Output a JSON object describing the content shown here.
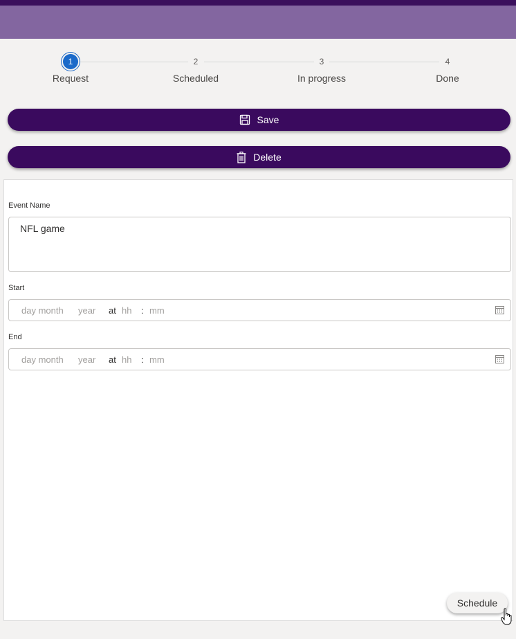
{
  "stepper": {
    "steps": [
      {
        "number": "1",
        "label": "Request",
        "state": "active"
      },
      {
        "number": "2",
        "label": "Scheduled",
        "state": "pending"
      },
      {
        "number": "3",
        "label": "In progress",
        "state": "pending"
      },
      {
        "number": "4",
        "label": "Done",
        "state": "pending"
      }
    ]
  },
  "actions": {
    "save_label": "Save",
    "save_icon": "save-icon",
    "delete_label": "Delete",
    "delete_icon": "trash-icon"
  },
  "form": {
    "event_name": {
      "label": "Event Name",
      "value": "NFL game"
    },
    "start": {
      "label": "Start",
      "day_month_placeholder": "day month",
      "year_placeholder": "year",
      "at": "at",
      "hh_placeholder": "hh",
      "sep": ":",
      "mm_placeholder": "mm",
      "icon": "calendar-icon"
    },
    "end": {
      "label": "End",
      "day_month_placeholder": "day month",
      "year_placeholder": "year",
      "at": "at",
      "hh_placeholder": "hh",
      "sep": ":",
      "mm_placeholder": "mm",
      "icon": "calendar-icon"
    }
  },
  "schedule_label": "Schedule",
  "colors": {
    "header_dark": "#3a0f5c",
    "header_band": "#8366a0",
    "button_primary": "#3a0a5e",
    "step_active": "#1b6ac9"
  }
}
